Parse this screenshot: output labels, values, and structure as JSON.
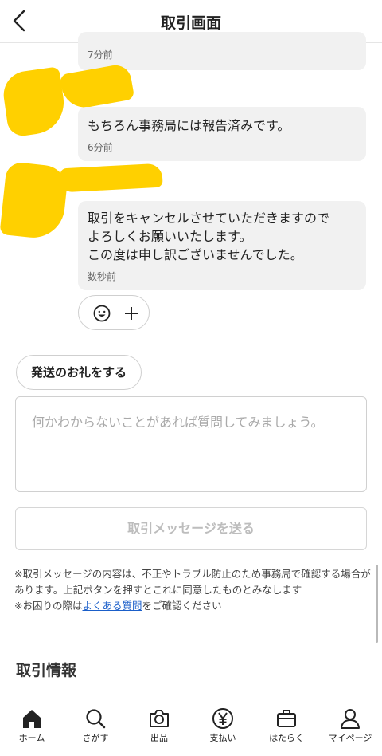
{
  "header": {
    "title": "取引画面",
    "back_icon": "chevron-left-icon"
  },
  "messages": [
    {
      "text": "",
      "time": "7分前"
    },
    {
      "text": "もちろん事務局には報告済みです。",
      "time": "6分前"
    },
    {
      "text": "取引をキャンセルさせていただきますので\nよろしくお願いいたします。\nこの度は申し訳ございませんでした。",
      "time": "数秒前"
    }
  ],
  "reaction": {
    "emoji_icon": "smile-icon",
    "add_icon": "plus-icon"
  },
  "thanks_button": "発送のお礼をする",
  "message_input": {
    "value": "",
    "placeholder": "何かわからないことがあれば質問してみましょう。"
  },
  "send_button": "取引メッセージを送る",
  "notice": {
    "line1": "※取引メッセージの内容は、不正やトラブル防止のため事務局で確認する場合があります。上記ボタンを押すとこれに同意したものとみなします",
    "line2_prefix": "※お困りの際は",
    "line2_link": "よくある質問",
    "line2_suffix": "をご確認ください"
  },
  "section_title": "取引情報",
  "tabs": [
    {
      "label": "ホーム",
      "icon": "home-icon"
    },
    {
      "label": "さがす",
      "icon": "search-icon"
    },
    {
      "label": "出品",
      "icon": "camera-icon"
    },
    {
      "label": "支払い",
      "icon": "yen-icon"
    },
    {
      "label": "はたらく",
      "icon": "briefcase-icon"
    },
    {
      "label": "マイページ",
      "icon": "person-icon"
    }
  ],
  "colors": {
    "redaction": "#ffd000",
    "link": "#1a5ec9",
    "bubble": "#f1f1f1"
  }
}
